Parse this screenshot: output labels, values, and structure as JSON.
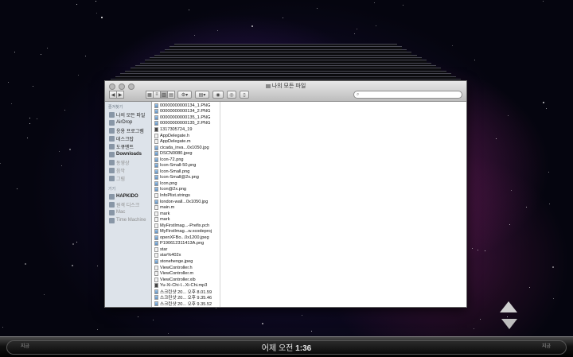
{
  "window": {
    "title": "나의 모든 파일",
    "view_buttons": [
      "icon",
      "list",
      "column",
      "coverflow"
    ],
    "search_placeholder": ""
  },
  "sidebar": {
    "favorites_header": "즐겨찾기",
    "favorites": [
      {
        "label": "나의 모든 파일",
        "icon": "all-files-icon"
      },
      {
        "label": "AirDrop",
        "icon": "airdrop-icon"
      },
      {
        "label": "응용 프로그램",
        "icon": "applications-icon"
      },
      {
        "label": "데스크탑",
        "icon": "desktop-icon"
      },
      {
        "label": "도큐멘트",
        "icon": "documents-icon"
      },
      {
        "label": "Downloads",
        "icon": "downloads-icon"
      },
      {
        "label": "동영상",
        "icon": "movies-icon"
      },
      {
        "label": "음악",
        "icon": "music-icon"
      },
      {
        "label": "그림",
        "icon": "pictures-icon"
      }
    ],
    "devices_header": "기기",
    "devices": [
      {
        "label": "HAPKIDO",
        "icon": "disk-icon"
      },
      {
        "label": "원격 디스크",
        "icon": "remote-disc-icon"
      },
      {
        "label": "Mac",
        "icon": "computer-icon"
      },
      {
        "label": "Time Machine",
        "icon": "time-machine-icon"
      }
    ]
  },
  "files": [
    {
      "name": "00000000000134_1.PNG",
      "kind": "img"
    },
    {
      "name": "00000000000134_2.PNG",
      "kind": "img"
    },
    {
      "name": "00000000000135_1.PNG",
      "kind": "img"
    },
    {
      "name": "00000000000135_2.PNG",
      "kind": "img"
    },
    {
      "name": "1317305724_19",
      "kind": "doc"
    },
    {
      "name": "AppDelegate.h",
      "kind": "file"
    },
    {
      "name": "AppDelegate.m",
      "kind": "file"
    },
    {
      "name": "cicada_inva...0x1050.jpg",
      "kind": "img"
    },
    {
      "name": "DSCN0080.jpeg",
      "kind": "img"
    },
    {
      "name": "Icon-72.png",
      "kind": "img"
    },
    {
      "name": "Icon-Small-50.png",
      "kind": "img"
    },
    {
      "name": "Icon-Small.png",
      "kind": "img"
    },
    {
      "name": "Icon-Small@2x.png",
      "kind": "img"
    },
    {
      "name": "Icon.png",
      "kind": "img"
    },
    {
      "name": "Icon@2x.png",
      "kind": "img"
    },
    {
      "name": "InfoPlist.strings",
      "kind": "file"
    },
    {
      "name": "london-wall...0x1050.jpg",
      "kind": "img"
    },
    {
      "name": "main.m",
      "kind": "file"
    },
    {
      "name": "mark",
      "kind": "file"
    },
    {
      "name": "mark",
      "kind": "file"
    },
    {
      "name": "MyFirstImag...-Prefix.pch",
      "kind": "file"
    },
    {
      "name": "MyFirstImag...w.xcodeproj",
      "kind": "img"
    },
    {
      "name": "openXFBo...0x1200.jpeg",
      "kind": "img"
    },
    {
      "name": "P190612311413A.png",
      "kind": "img"
    },
    {
      "name": "star",
      "kind": "file"
    },
    {
      "name": "star%402x",
      "kind": "file"
    },
    {
      "name": "stonehenge.jpeg",
      "kind": "img"
    },
    {
      "name": "ViewController.h",
      "kind": "file"
    },
    {
      "name": "ViewController.m",
      "kind": "file"
    },
    {
      "name": "ViewController.xib",
      "kind": "file"
    },
    {
      "name": "Yu-Xi-Chi-I...Xi-Chi.mp3",
      "kind": "doc"
    },
    {
      "name": "스크린샷 20... 오후 8.01.59",
      "kind": "img"
    },
    {
      "name": "스크린샷 20... 오후 9.35.46",
      "kind": "img"
    },
    {
      "name": "스크린샷 20... 오후 9.35.52",
      "kind": "img"
    }
  ],
  "timeline": {
    "prefix": "어제 오전",
    "time": "1:36",
    "left_label": "지금",
    "right_label": "지금"
  }
}
